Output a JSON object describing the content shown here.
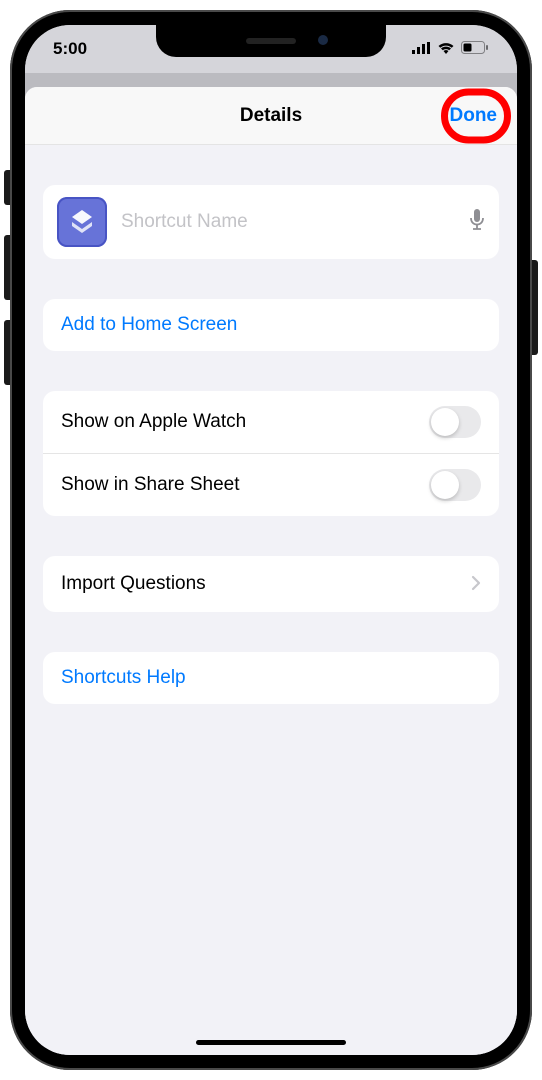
{
  "status": {
    "time": "5:00"
  },
  "nav": {
    "title": "Details",
    "done": "Done"
  },
  "name_field": {
    "placeholder": "Shortcut Name",
    "value": ""
  },
  "actions": {
    "add_home": "Add to Home Screen"
  },
  "toggles": {
    "apple_watch": "Show on Apple Watch",
    "share_sheet": "Show in Share Sheet"
  },
  "links": {
    "import": "Import Questions",
    "help": "Shortcuts Help"
  }
}
